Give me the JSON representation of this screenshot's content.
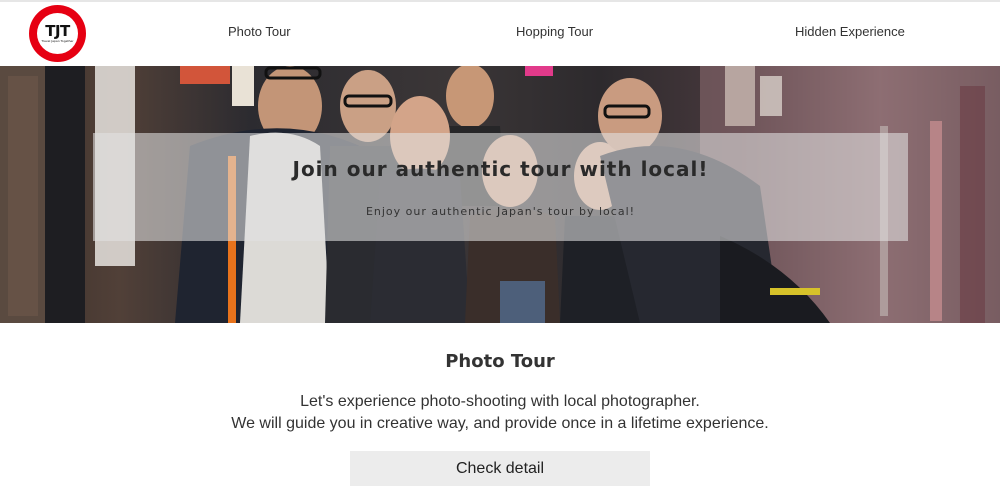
{
  "header": {
    "logo": {
      "text": "TJT",
      "subtext": "Travel Japan Together",
      "color": "#e60012"
    },
    "nav": [
      {
        "label": "Photo Tour"
      },
      {
        "label": "Hopping Tour"
      },
      {
        "label": "Hidden Experience"
      }
    ]
  },
  "hero": {
    "image": "group-photo-in-alley",
    "title": "Join our authentic tour with local!",
    "subtitle": "Enjoy our authentic Japan's tour by local!"
  },
  "section": {
    "title": "Photo Tour",
    "description_line1": "Let's experience photo-shooting with local photographer.",
    "description_line2": "We will guide you in creative way, and provide once in a lifetime experience.",
    "button_label": "Check detail"
  }
}
